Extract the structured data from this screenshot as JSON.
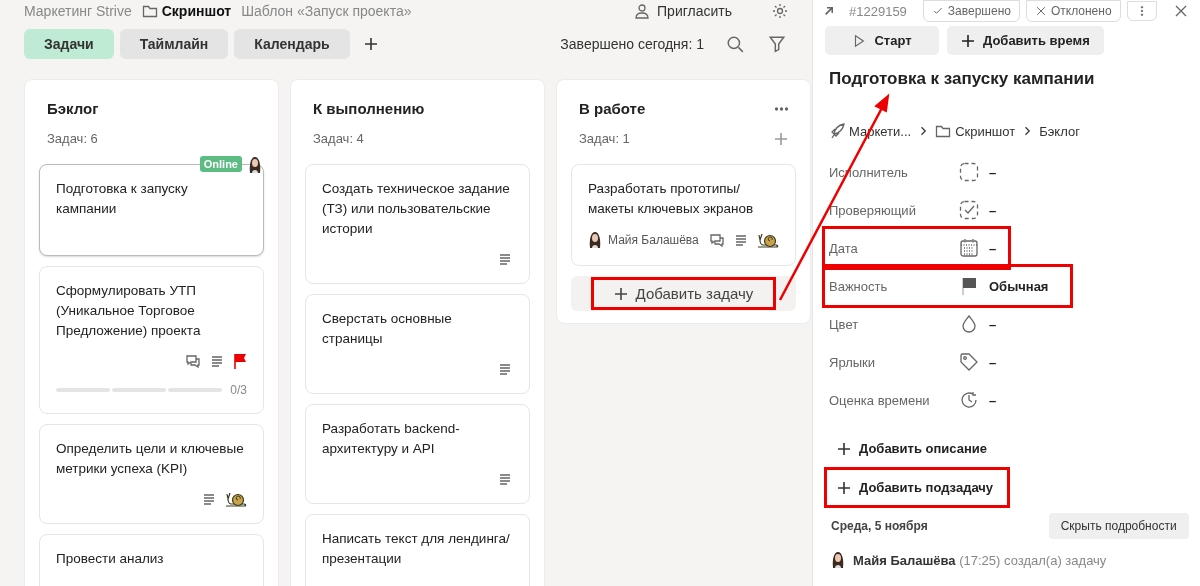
{
  "topbar": {
    "workspace": "Маркетинг Strive",
    "project": "Скриншот",
    "template": "Шаблон «Запуск проекта»",
    "invite": "Пригласить"
  },
  "tabs": [
    {
      "label": "Задачи",
      "selected": true
    },
    {
      "label": "Таймлайн",
      "selected": false
    },
    {
      "label": "Календарь",
      "selected": false
    }
  ],
  "completed_today": "Завершено сегодня: 1",
  "columns": [
    {
      "title": "Бэклог",
      "count": "Задач: 6",
      "menu": false,
      "cards": [
        {
          "title": "Подготовка к запуску кампании",
          "selected": true,
          "badge": "Online"
        },
        {
          "title": "Сформулировать УТП (Уникальное Торговое Предложение) проекта",
          "selected": false,
          "markers": [
            {
              "kind": "comments"
            },
            {
              "kind": "description"
            },
            {
              "kind": "high_priority"
            }
          ],
          "subtasks": {
            "level": 0,
            "label": "0/3"
          }
        },
        {
          "title": "Определить цели и ключевые метрики успеха (KPI)",
          "selected": false,
          "markers": [
            {
              "kind": "description"
            },
            {
              "kind": "low_priority"
            }
          ]
        },
        {
          "title": "Провести анализ",
          "selected": false
        }
      ]
    },
    {
      "title": "К выполнению",
      "count": "Задач: 4",
      "menu": false,
      "cards": [
        {
          "title": "Создать техническое задание (ТЗ) или пользовательские истории",
          "selected": false,
          "markers": [
            {
              "kind": "description"
            }
          ]
        },
        {
          "title": "Сверстать основные страницы",
          "selected": false,
          "markers": [
            {
              "kind": "description"
            }
          ]
        },
        {
          "title": "Разработать backend-архитектуру и API",
          "selected": false,
          "markers": [
            {
              "kind": "description"
            }
          ]
        },
        {
          "title": "Написать текст для лендинга/презентации",
          "selected": false
        }
      ]
    },
    {
      "title": "В работе",
      "count": "Задач: 1",
      "menu": true,
      "cards": [
        {
          "title": "Разработать прототипы/ макеты ключевых экранов",
          "selected": false,
          "assignee": "Майя Балашёва",
          "markers": [
            {
              "kind": "comments"
            },
            {
              "kind": "description"
            },
            {
              "kind": "low_priority"
            }
          ]
        }
      ],
      "add_task": {
        "label": "Добавить задачу",
        "highlighted": true
      }
    }
  ],
  "panel": {
    "task_id": "#1229159",
    "status_buttons": [
      "Завершено",
      "Отклонено"
    ],
    "start": "Старт",
    "add_time": "Добавить время",
    "title": "Подготовка к запуску кампании",
    "path": [
      "Маркети...",
      "Скриншот",
      "Бэклог"
    ],
    "fields": [
      {
        "kind": "assignee",
        "label": "Исполнитель",
        "value": "–",
        "highlighted": false
      },
      {
        "kind": "reviewer",
        "label": "Проверяющий",
        "value": "–",
        "highlighted": false
      },
      {
        "kind": "date",
        "label": "Дата",
        "value": "–",
        "highlighted": true
      },
      {
        "kind": "priority",
        "label": "Важность",
        "value": "Обычная",
        "highlighted": true
      },
      {
        "kind": "color",
        "label": "Цвет",
        "value": "–",
        "highlighted": false
      },
      {
        "kind": "labels",
        "label": "Ярлыки",
        "value": "–",
        "highlighted": false
      },
      {
        "kind": "estimate",
        "label": "Оценка времени",
        "value": "–",
        "highlighted": false
      }
    ],
    "actions": [
      {
        "label": "Добавить описание",
        "highlighted": false
      },
      {
        "label": "Добавить подзадачу",
        "highlighted": true
      }
    ],
    "activity_date": "Среда, 5 ноября",
    "hide_details": "Скрыть подробности",
    "activity": [
      {
        "user": "Майя Балашёва",
        "time": "(17:25)",
        "text": "создал(а) задачу"
      }
    ]
  }
}
